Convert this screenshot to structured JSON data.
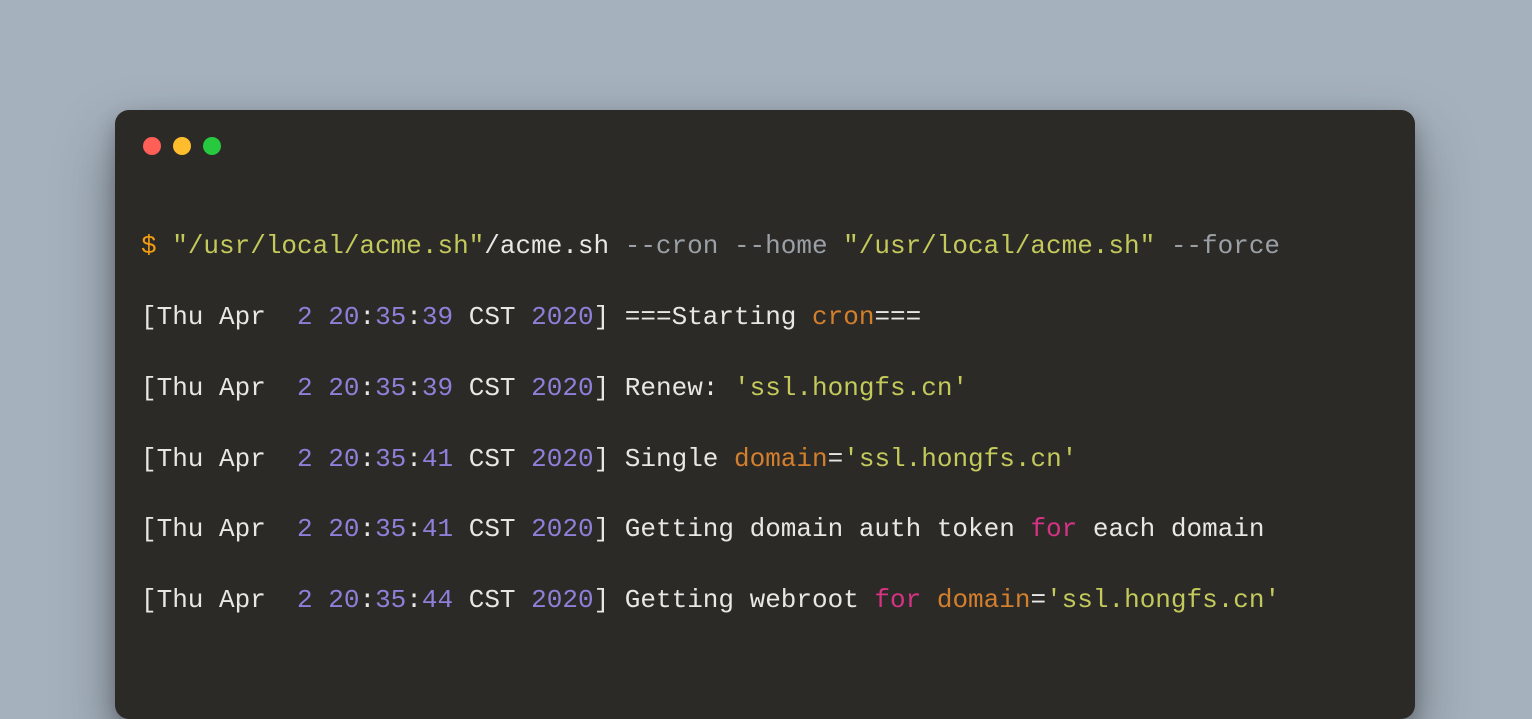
{
  "colors": {
    "background": "#a5b1bd",
    "terminal": "#2b2a27",
    "dot_red": "#ff5f56",
    "dot_yellow": "#ffbd2e",
    "dot_green": "#27c93f",
    "text_default": "#e8e7e3",
    "text_prompt": "#f39c12",
    "text_string": "#c3c95a",
    "text_number": "#8f7fd8",
    "text_keyword": "#d47f2c",
    "text_for": "#d63384",
    "text_flag": "#9aa0a6"
  },
  "cmd": {
    "prompt": "$ ",
    "q1": "\"/usr/local/acme.sh\"",
    "path": "/acme.sh ",
    "flag1": "--cron ",
    "flag2": "--home ",
    "q2": "\"/usr/local/acme.sh\" ",
    "flag3": "--force"
  },
  "l1": {
    "open": "[Thu Apr  ",
    "day": "2",
    "sp1": " ",
    "h": "20",
    "c1": ":",
    "m": "35",
    "c2": ":",
    "s": "39",
    "tz": " CST ",
    "y": "2020",
    "close": "] ",
    "eq1": "===Starting ",
    "kw": "cron",
    "eq2": "==="
  },
  "l2": {
    "open": "[Thu Apr  ",
    "day": "2",
    "sp1": " ",
    "h": "20",
    "c1": ":",
    "m": "35",
    "c2": ":",
    "s": "39",
    "tz": " CST ",
    "y": "2020",
    "close": "] ",
    "t1": "Renew: ",
    "q": "'ssl.hongfs.cn'"
  },
  "l3": {
    "open": "[Thu Apr  ",
    "day": "2",
    "sp1": " ",
    "h": "20",
    "c1": ":",
    "m": "35",
    "c2": ":",
    "s": "41",
    "tz": " CST ",
    "y": "2020",
    "close": "] ",
    "t1": "Single ",
    "kw": "domain",
    "eq": "=",
    "q": "'ssl.hongfs.cn'"
  },
  "l4": {
    "open": "[Thu Apr  ",
    "day": "2",
    "sp1": " ",
    "h": "20",
    "c1": ":",
    "m": "35",
    "c2": ":",
    "s": "41",
    "tz": " CST ",
    "y": "2020",
    "close": "] ",
    "t1": "Getting domain auth token ",
    "for": "for",
    "t2": " each domain"
  },
  "l5": {
    "open": "[Thu Apr  ",
    "day": "2",
    "sp1": " ",
    "h": "20",
    "c1": ":",
    "m": "35",
    "c2": ":",
    "s": "44",
    "tz": " CST ",
    "y": "2020",
    "close": "] ",
    "t1": "Getting webroot ",
    "for": "for",
    "sp": " ",
    "kw": "domain",
    "eq": "=",
    "q": "'ssl.hongfs.cn'"
  }
}
